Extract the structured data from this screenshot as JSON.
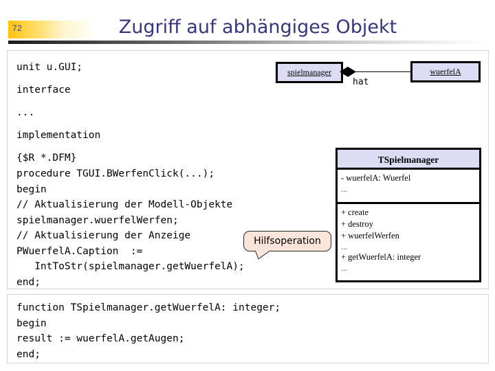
{
  "header": {
    "page_number": "72",
    "title": "Zugriff auf abhängiges Objekt",
    "title_color": "#363680",
    "band_color": "#FFC20E"
  },
  "code_blocks": {
    "unit_header": "unit u.GUI;\ninterface\n...\nimplementation\n{$R *.DFM}",
    "procedure": "procedure TGUI.BWerfenClick(...);\nbegin\n// Aktualisierung der Modell-Objekte\nspielmanager.wuerfelWerfen;\n// Aktualisierung der Anzeige\nPWuerfelA.Caption  :=\n   IntToStr(spielmanager.getWuerfelA);\nend;",
    "function": "function TSpielmanager.getWuerfelA: integer;\nbegin\nresult := wuerfelA.getAugen;\nend;"
  },
  "object_diagram": {
    "left_object": "spielmanager",
    "right_object": "wuerfelA",
    "association_label": "hat",
    "association_kind": "composition",
    "box_fill": "#DCDCF5"
  },
  "class_box": {
    "name": "TSpielmanager",
    "attributes": [
      "- wuerfelA: Wuerfel",
      "..."
    ],
    "operations": [
      "+ create",
      "+ destroy",
      "+ wuerfelWerfen",
      "...",
      "+ getWuerfelA: integer",
      "..."
    ],
    "header_fill": "#DCDCF5"
  },
  "callout": {
    "label": "Hilfsoperation",
    "fill": "#FBE4DA"
  }
}
